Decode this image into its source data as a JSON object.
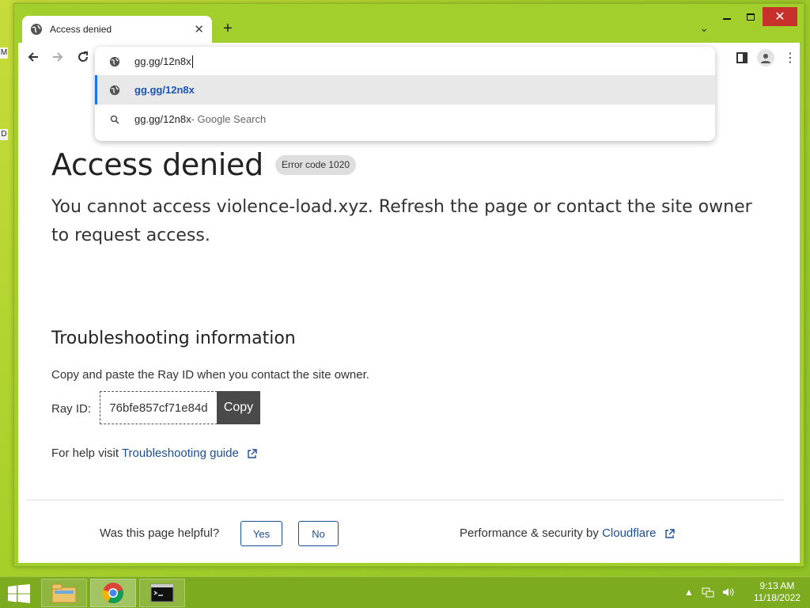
{
  "desktop": {
    "icon_1": "M",
    "icon_2": "D"
  },
  "browser": {
    "tab": {
      "title": "Access denied"
    },
    "new_tab_symbol": "+",
    "omnibox": {
      "input_value": "gg.gg/12n8x",
      "suggestions": [
        {
          "text": "gg.gg/12n8x",
          "suffix": ""
        },
        {
          "text": "gg.gg/12n8x",
          "suffix": " - Google Search"
        }
      ]
    }
  },
  "page": {
    "title": "Access denied",
    "error_badge": "Error code 1020",
    "lead": "You cannot access violence-load.xyz. Refresh the page or contact the site owner to request access.",
    "troubleshooting_heading": "Troubleshooting information",
    "instruction": "Copy and paste the Ray ID when you contact the site owner.",
    "ray_label": "Ray ID:",
    "ray_id": "76bfe857cf71e84d",
    "copy_label": "Copy",
    "help_prefix": "For help visit ",
    "help_link": "Troubleshooting guide",
    "helpful_question": "Was this page helpful?",
    "yes_label": "Yes",
    "no_label": "No",
    "perf_prefix": "Performance & security by ",
    "perf_link": "Cloudflare"
  },
  "taskbar": {
    "time": "9:13 AM",
    "date": "11/18/2022"
  },
  "colors": {
    "link": "#1c4e96",
    "accent": "#1a73e8",
    "desktop": "#a6cf2a",
    "close": "#c8302c"
  }
}
